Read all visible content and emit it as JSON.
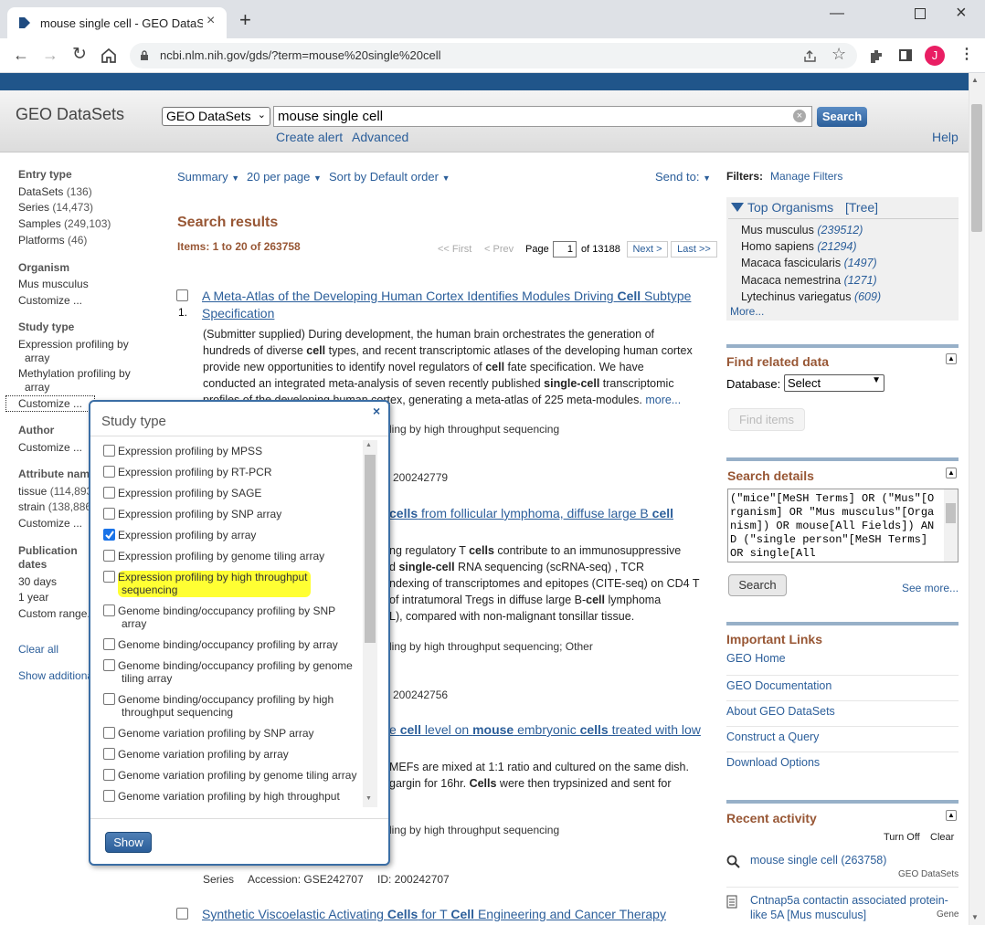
{
  "browser": {
    "tab_title": "mouse single cell - GEO DataSets",
    "url": "ncbi.nlm.nih.gov/gds/?term=mouse%20single%20cell",
    "new_tab": "+",
    "profile_initial": "J",
    "accent": "#e91e63"
  },
  "header": {
    "db_title": "GEO DataSets",
    "db_select": "GEO DataSets",
    "search_value": "mouse single cell",
    "search_button": "Search",
    "create_alert": "Create alert",
    "advanced": "Advanced",
    "help": "Help"
  },
  "sidebar": {
    "entry_type": {
      "title": "Entry type",
      "items": [
        {
          "label": "DataSets",
          "count": "(136)"
        },
        {
          "label": "Series",
          "count": "(14,473)"
        },
        {
          "label": "Samples",
          "count": "(249,103)"
        },
        {
          "label": "Platforms",
          "count": "(46)"
        }
      ]
    },
    "organism": {
      "title": "Organism",
      "items": [
        "Mus musculus",
        "Customize ..."
      ]
    },
    "study_type": {
      "title": "Study type",
      "items": [
        "Expression profiling by",
        "array",
        "Methylation profiling by",
        "array",
        "Customize ..."
      ]
    },
    "author": {
      "title": "Author",
      "customize": "Customize ..."
    },
    "attribute": {
      "title": "Attribute nam",
      "tissue": "tissue",
      "tissue_count": "(114,893",
      "strain": "strain",
      "strain_count": "(138,886",
      "customize": "Customize ..."
    },
    "pubdates": {
      "title1": "Publication",
      "title2": "dates",
      "items": [
        "30 days",
        "1 year",
        "Custom range..."
      ]
    },
    "clear_all": "Clear all",
    "show_additional": "Show additiona"
  },
  "results_bar": {
    "summary": "Summary",
    "per_page": "20 per page",
    "sort": "Sort by Default order",
    "send_to": "Send to:"
  },
  "results": {
    "heading": "Search results",
    "items": "Items: 1 to 20 of 263758",
    "first": "<< First",
    "prev": "< Prev",
    "page_label": "Page",
    "page_value": "1",
    "of_pages": "of 13188",
    "next": "Next >",
    "last": "Last >>",
    "r1_num": "1.",
    "r1_title_a": "A Meta-Atlas of the Developing Human Cortex Identifies Modules Driving ",
    "r1_title_b": "Cell",
    "r1_title_c": " Subtype",
    "r1_title_d": "Specification",
    "r1_l1": "(Submitter supplied) During development, the human brain orchestrates the generation of",
    "r1_l2a": "hundreds of diverse ",
    "r1_l2b": "cell",
    "r1_l2c": " types, and recent transcriptomic atlases of the developing human cortex",
    "r1_l3": "provide new opportunities to identify novel regulators of ",
    "r1_l3b": "cell",
    "r1_l3c": " fate specification. We have",
    "r1_l4a": "conducted an integrated meta-analysis of seven recently published ",
    "r1_l4b": "single-cell",
    "r1_l4c": " transcriptomic",
    "r1_l5": "profiles of the developing human cortex, generating a meta-atlas of 225 meta-modules.",
    "more": "more...",
    "r1_type": "ling by high throughput sequencing",
    "r1_id": "200242779",
    "r2_title_a": "cells",
    "r2_title_b": " from follicular lymphoma, diffuse large B ",
    "r2_title_c": "cell",
    "r2_l1a": "ng regulatory T ",
    "r2_l1b": "cells",
    "r2_l1c": " contribute to an immunosuppressive",
    "r2_l2a": "d ",
    "r2_l2b": "single-cell",
    "r2_l2c": " RNA sequencing (scRNA-seq) , TCR",
    "r2_l3": "ndexing of transcriptomes and epitopes (CITE-seq) on CD4 T",
    "r2_l4a": "of intratumoral Tregs in diffuse large B-",
    "r2_l4b": "cell",
    "r2_l4c": " lymphoma",
    "r2_l5": "L), compared with non-malignant tonsillar tissue.",
    "r2_type": "ling by high throughput sequencing; Other",
    "r2_id": "200242756",
    "r3_title_a": "e ",
    "r3_title_b": "cell",
    "r3_title_c": " level on ",
    "r3_title_d": "mouse",
    "r3_title_e": " embryonic ",
    "r3_title_f": "cells",
    "r3_title_g": " treated with low",
    "r3_l1": "MEFs are mixed at 1:1 ratio and cultured on the same dish.",
    "r3_l2a": "gargin for 16hr. ",
    "r3_l2b": "Cells",
    "r3_l2c": " were then trypsinized and sent for",
    "r3_type": "ling by high throughput sequencing",
    "r3_series": "Series",
    "r3_acc": "Accession: GSE242707",
    "r3_id": "ID: 200242707",
    "r4_title_a": "Synthetic Viscoelastic Activating ",
    "r4_title_b": "Cells",
    "r4_title_c": " for T ",
    "r4_title_d": "Cell",
    "r4_title_e": " Engineering and Cancer Therapy"
  },
  "popup": {
    "title": "Study type",
    "close": "×",
    "options": [
      {
        "label": "Expression profiling by MPSS",
        "checked": false
      },
      {
        "label": "Expression profiling by RT-PCR",
        "checked": false
      },
      {
        "label": "Expression profiling by SAGE",
        "checked": false
      },
      {
        "label": "Expression profiling by SNP array",
        "checked": false
      },
      {
        "label": "Expression profiling by array",
        "checked": true
      },
      {
        "label": "Expression profiling by genome tiling array",
        "checked": false
      },
      {
        "label": "Expression profiling by high throughput",
        "label2": "sequencing",
        "checked": false,
        "highlight": true
      },
      {
        "label": "Genome binding/occupancy profiling by SNP",
        "label2": "array",
        "checked": false
      },
      {
        "label": "Genome binding/occupancy profiling by array",
        "checked": false
      },
      {
        "label": "Genome binding/occupancy profiling by genome",
        "label2": "tiling array",
        "checked": false
      },
      {
        "label": "Genome binding/occupancy profiling by high",
        "label2": "throughput sequencing",
        "checked": false
      },
      {
        "label": "Genome variation profiling by SNP array",
        "checked": false
      },
      {
        "label": "Genome variation profiling by array",
        "checked": false
      },
      {
        "label": "Genome variation profiling by genome tiling array",
        "checked": false
      },
      {
        "label": "Genome variation profiling by high throughput",
        "checked": false
      }
    ],
    "show_button": "Show",
    "highlight_color": "#ffff33"
  },
  "right": {
    "filters": "Filters:",
    "manage": "Manage Filters",
    "top_org": "Top Organisms",
    "tree": "[Tree]",
    "orgs": [
      {
        "name": "Mus musculus",
        "count": "(239512)"
      },
      {
        "name": "Homo sapiens",
        "count": "(21294)"
      },
      {
        "name": "Macaca fascicularis",
        "count": "(1497)"
      },
      {
        "name": "Macaca nemestrina",
        "count": "(1271)"
      },
      {
        "name": "Lytechinus variegatus",
        "count": "(609)"
      }
    ],
    "more": "More...",
    "find_related": "Find related data",
    "database_label": "Database:",
    "database_value": "Select",
    "find_items": "Find items",
    "search_details": "Search details",
    "details_text": "(\"mice\"[MeSH Terms] OR (\"Mus\"[Organism] OR \"Mus musculus\"[Organism]) OR mouse[All Fields]) AND (\"single person\"[MeSH Terms] OR single[All",
    "details_search": "Search",
    "see_more": "See more...",
    "important_links": "Important Links",
    "links": [
      "GEO Home",
      "GEO Documentation",
      "About GEO DataSets",
      "Construct a Query",
      "Download Options"
    ],
    "recent": "Recent activity",
    "turn_off": "Turn Off",
    "clear": "Clear",
    "recent1": "mouse single cell (263758)",
    "recent1_db": "GEO DataSets",
    "recent2a": "Cntnap5a contactin associated protein-",
    "recent2b": "like 5A [Mus musculus]",
    "recent2_db": "Gene"
  }
}
